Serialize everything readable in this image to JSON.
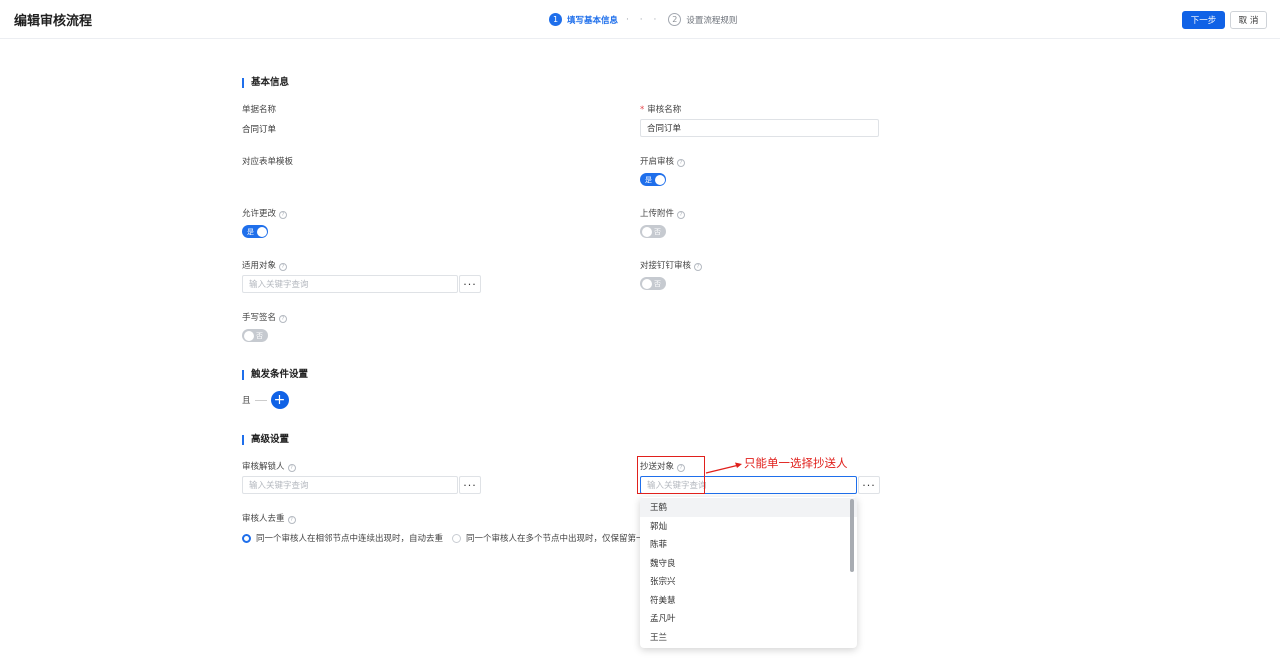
{
  "header": {
    "title": "编辑审核流程",
    "steps": [
      {
        "num": "1",
        "label": "填写基本信息",
        "active": true
      },
      {
        "num": "2",
        "label": "设置流程规则",
        "active": false
      }
    ],
    "step_dots": "· · ·",
    "next_label": "下一步",
    "cancel_label": "取 消"
  },
  "basic": {
    "title": "基本信息",
    "doc_name_label": "单据名称",
    "doc_name_value": "合同订单",
    "review_name_label": "审核名称",
    "review_name_required": "*",
    "review_name_value": "合同订单",
    "form_template_label": "对应表单模板",
    "enable_review_label": "开启审核",
    "enable_review": {
      "on": true,
      "text": "是"
    },
    "allow_change_label": "允许更改",
    "allow_change": {
      "on": true,
      "text": "是"
    },
    "upload_attach_label": "上传附件",
    "upload_attach": {
      "on": false,
      "text": "否"
    },
    "applicable_label": "适用对象",
    "applicable_placeholder": "输入关键字查询",
    "dingtalk_label": "对接钉钉审核",
    "dingtalk": {
      "on": false,
      "text": "否"
    },
    "signature_label": "手写签名",
    "signature": {
      "on": false,
      "text": "否"
    },
    "help_glyph": "?",
    "more_glyph": "···"
  },
  "trigger": {
    "title": "触发条件设置",
    "and_label": "且",
    "add_glyph": "+"
  },
  "advanced": {
    "title": "高级设置",
    "unlock_label": "审核解锁人",
    "unlock_placeholder": "输入关键字查询",
    "cc_label": "抄送对象",
    "cc_placeholder": "输入关键字查询",
    "dedupe_label": "审核人去重",
    "radio_options": [
      {
        "label": "同一个审核人在相邻节点中连续出现时，自动去重",
        "checked": true
      },
      {
        "label": "同一个审核人在多个节点中出现时，仅保留第一个",
        "checked": false
      }
    ]
  },
  "dropdown": {
    "items": [
      "王鹤",
      "郭灿",
      "陈菲",
      "魏守良",
      "张宗兴",
      "符美慧",
      "孟凡叶",
      "王兰"
    ]
  },
  "annotation": {
    "text": "只能单一选择抄送人",
    "color": "#e0201c"
  },
  "colors": {
    "primary": "#1062e6",
    "accent": "#1f6feb",
    "annotation": "#e0201c"
  }
}
